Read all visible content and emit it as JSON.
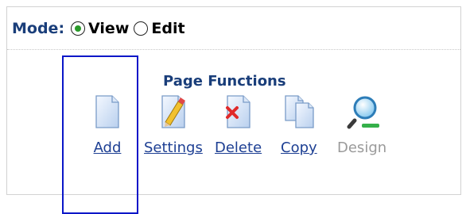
{
  "mode": {
    "label": "Mode:",
    "options": [
      {
        "label": "View",
        "selected": true
      },
      {
        "label": "Edit",
        "selected": false
      }
    ]
  },
  "page_functions": {
    "title": "Page Functions",
    "items": [
      {
        "label": "Add",
        "icon": "page-icon",
        "enabled": true
      },
      {
        "label": "Settings",
        "icon": "page-pencil-icon",
        "enabled": true
      },
      {
        "label": "Delete",
        "icon": "page-delete-icon",
        "enabled": true
      },
      {
        "label": "Copy",
        "icon": "copy-pages-icon",
        "enabled": true
      },
      {
        "label": "Design",
        "icon": "magnifier-icon",
        "enabled": false
      }
    ]
  },
  "colors": {
    "link": "#1d3f93",
    "disabled": "#9a9a9a",
    "highlight_border": "#0a16c8",
    "radio_selected": "#2a9a2a"
  }
}
